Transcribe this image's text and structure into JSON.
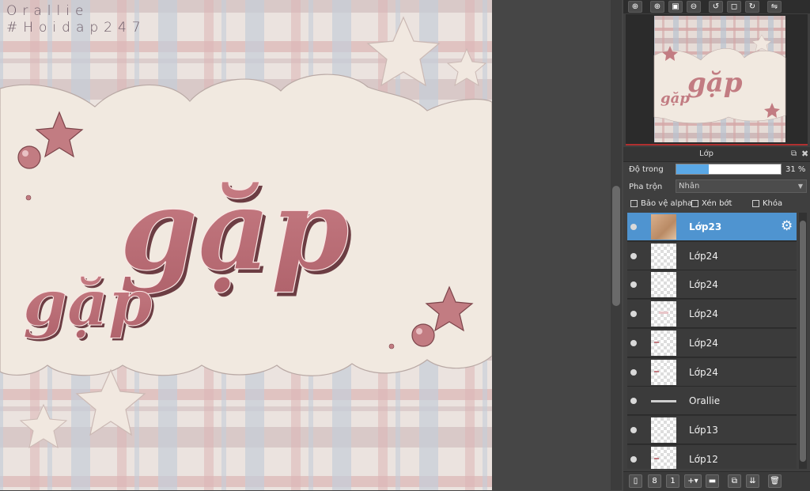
{
  "watermark": {
    "line1": "Orallie",
    "line2": "#Hoidap247"
  },
  "artwork": {
    "big_word": "gặp",
    "small_word": "gặp"
  },
  "nav_toolbar": {
    "icons": [
      "zoom-in-icon",
      "zoom-in-plus-icon",
      "fit-window-icon",
      "zoom-out-icon",
      "rotate-left-icon",
      "actual-size-icon",
      "rotate-right-icon",
      "flip-icon"
    ]
  },
  "layer_panel": {
    "title": "Lớp",
    "opacity_label": "Độ trong",
    "opacity_value": "31 %",
    "opacity_fraction": 0.31,
    "blend_label": "Pha trộn",
    "blend_value": "Nhân",
    "protect_alpha_label": "Bảo vệ alpha",
    "clip_label": "Xén bớt",
    "lock_label": "Khóa",
    "layers": [
      {
        "name": "Lớp23",
        "selected": true,
        "thumb": "photo"
      },
      {
        "name": "Lớp24",
        "selected": false,
        "thumb": "gặp"
      },
      {
        "name": "Lớp24",
        "selected": false,
        "thumb": "gặp"
      },
      {
        "name": "Lớp24",
        "selected": false,
        "thumb": "faint"
      },
      {
        "name": "Lớp24",
        "selected": false,
        "thumb": "mark"
      },
      {
        "name": "Lớp24",
        "selected": false,
        "thumb": "mark"
      },
      {
        "name": "Orallie",
        "selected": false,
        "thumb": "line"
      },
      {
        "name": "Lớp13",
        "selected": false,
        "thumb": "empty"
      },
      {
        "name": "Lớp12",
        "selected": false,
        "thumb": "mark"
      }
    ]
  },
  "bottom_toolbar": {
    "icons": [
      "new-layer-icon",
      "new-8bit-layer-icon",
      "new-1bit-layer-icon",
      "add-layer-menu-icon",
      "folder-icon",
      "duplicate-layer-icon",
      "merge-layer-icon",
      "delete-layer-icon"
    ]
  },
  "colors": {
    "accent": "#4f94d0",
    "pink": "#c27c82",
    "panel": "#3f3f3f"
  }
}
